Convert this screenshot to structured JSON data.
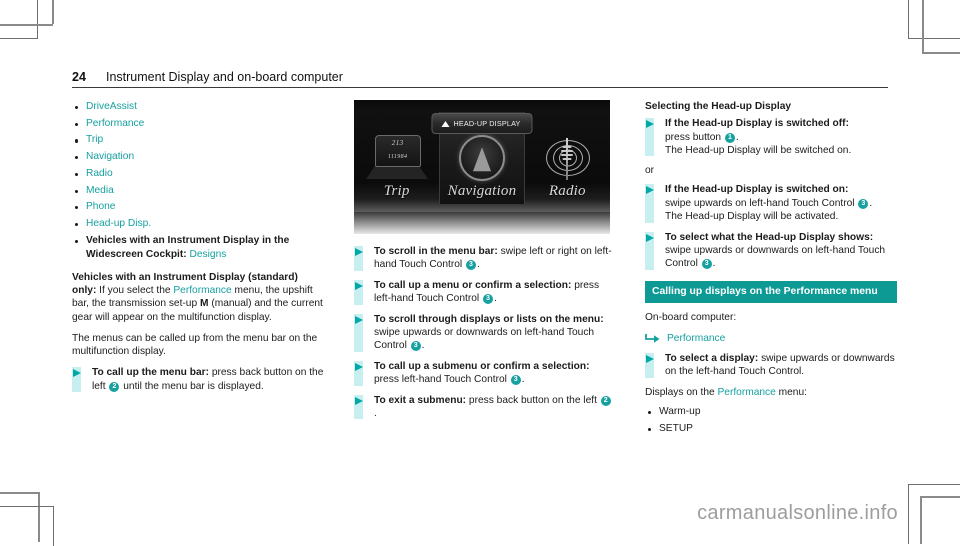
{
  "header": {
    "page_number": "24",
    "chapter": "Instrument Display and on-board computer"
  },
  "column_left": {
    "menu_items": [
      "DriveAssist",
      "Performance",
      "Trip",
      "Navigation",
      "Radio",
      "Media",
      "Phone",
      "Head-up Disp."
    ],
    "widescreen_item_bold": "Vehicles with an Instrument Display in the Widescreen Cockpit:",
    "widescreen_item_link": "Designs",
    "para_standard_bold": "Vehicles with an Instrument Display (standard) only:",
    "para_standard_text_1": " If you select the ",
    "para_standard_link": "Performance",
    "para_standard_text_2": " menu, the upshift bar, the transmission set-up ",
    "para_standard_bold_m": "M",
    "para_standard_text_3": " (manual) and the current gear will appear on the multifunction display.",
    "para_menus": "The menus can be called up from the menu bar on the multifunction display.",
    "instr_menubar_bold": "To call up the menu bar:",
    "instr_menubar_text_1": " press back button on the left ",
    "instr_menubar_badge": "2",
    "instr_menubar_text_2": " until the menu bar is displayed."
  },
  "figure": {
    "hud_label": "HEAD-UP DISPLAY",
    "tiles": [
      {
        "label": "Trip",
        "icon": "trip-computer-icon"
      },
      {
        "label": "Navigation",
        "icon": "compass-arrow-icon"
      },
      {
        "label": "Radio",
        "icon": "antenna-tower-icon"
      }
    ],
    "trip_value_top": "213",
    "trip_value_bottom": "111984"
  },
  "column_middle": {
    "instructions": [
      {
        "bold": "To scroll in the menu bar:",
        "text_1": " swipe left or right on left-hand Touch Control ",
        "badge": "3",
        "text_2": "."
      },
      {
        "bold": "To call up a menu or confirm a selection:",
        "text_1": " press left-hand Touch Control ",
        "badge": "3",
        "text_2": "."
      },
      {
        "bold": "To scroll through displays or lists on the menu:",
        "text_1": " swipe upwards or downwards on left-hand Touch Control ",
        "badge": "3",
        "text_2": "."
      },
      {
        "bold": "To call up a submenu or confirm a selection:",
        "text_1": " press left-hand Touch Control ",
        "badge": "3",
        "text_2": "."
      },
      {
        "bold": "To exit a submenu:",
        "text_1": " press back button on the left ",
        "badge": "2",
        "text_2": "."
      }
    ]
  },
  "column_right": {
    "heading": "Selecting the Head-up Display",
    "instr_off_bold": "If the Head-up Display is switched off:",
    "instr_off_text_1": " press button ",
    "instr_off_badge": "1",
    "instr_off_text_2": ".",
    "instr_off_result": "The Head-up Display will be switched on.",
    "or": "or",
    "instr_on_bold": "If the Head-up Display is switched on:",
    "instr_on_text_1": " swipe upwards on left-hand Touch Control ",
    "instr_on_badge": "3",
    "instr_on_text_2": ".",
    "instr_on_result": "The Head-up Display will be activated.",
    "instr_select_bold": "To select what the Head-up Display shows:",
    "instr_select_text_1": " swipe upwards or downwards on left-hand Touch Control ",
    "instr_select_badge": "3",
    "instr_select_text_2": ".",
    "section_bar": "Calling up displays on the Performance menu",
    "onboard_label": "On-board computer:",
    "menu_path": "Performance",
    "instr_display_bold": "To select a display:",
    "instr_display_text": " swipe upwards or downwards on the left-hand Touch Control.",
    "displays_intro_1": "Displays on the ",
    "displays_intro_link": "Performance",
    "displays_intro_2": " menu:",
    "display_items": [
      "Warm-up",
      "SETUP"
    ]
  },
  "watermark": "carmanualsonline.info",
  "colors": {
    "teal_link": "#16a0a0",
    "teal_bar": "#0e9a94",
    "cyan_rule": "#c8efef",
    "triangle": "#00a8a8"
  }
}
